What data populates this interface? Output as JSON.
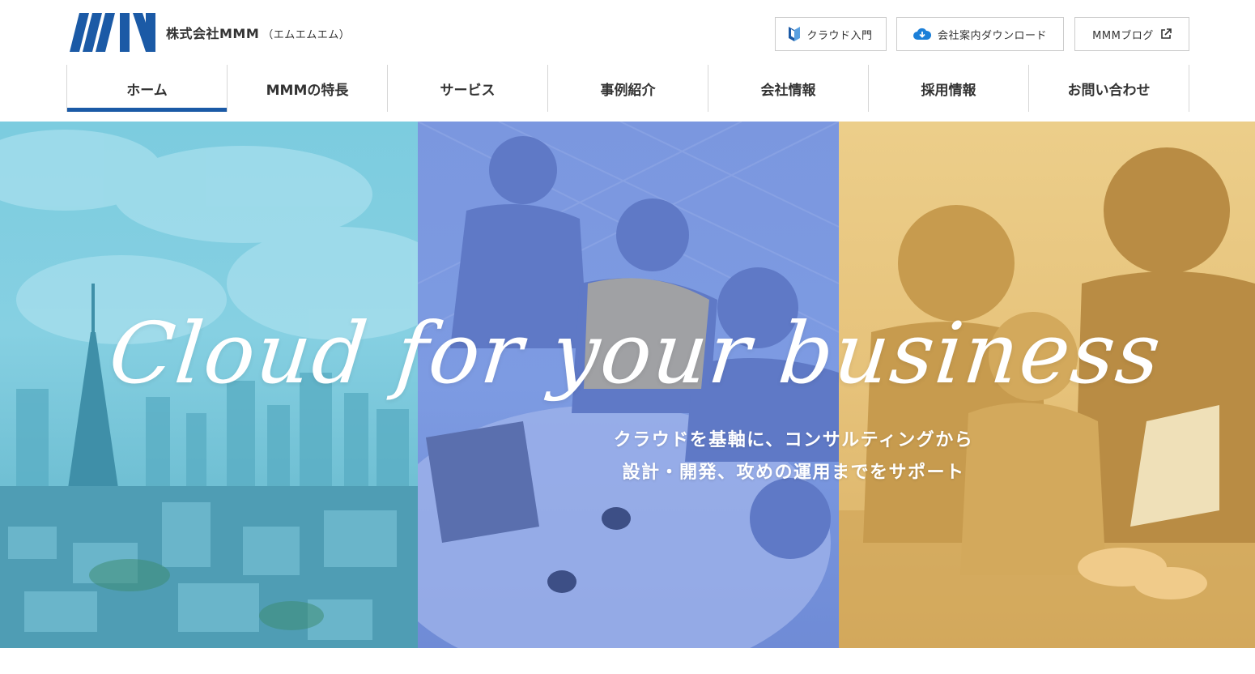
{
  "header": {
    "company_name": "株式会社MMM",
    "company_reading": "（エムエムエム）",
    "logo_alt": "MMM logo"
  },
  "utility_links": [
    {
      "label": "クラウド入門",
      "icon": "shield-beginner-icon"
    },
    {
      "label": "会社案内ダウンロード",
      "icon": "cloud-download-icon"
    },
    {
      "label": "MMMブログ",
      "icon": "external-link-icon"
    }
  ],
  "nav": {
    "items": [
      {
        "label": "ホーム",
        "active": true
      },
      {
        "label": "MMMの特長",
        "active": false
      },
      {
        "label": "サービス",
        "active": false
      },
      {
        "label": "事例紹介",
        "active": false
      },
      {
        "label": "会社情報",
        "active": false
      },
      {
        "label": "採用情報",
        "active": false
      },
      {
        "label": "お問い合わせ",
        "active": false
      }
    ]
  },
  "hero": {
    "title": "Cloud for your business",
    "subtitle_line1": "クラウドを基軸に、コンサルティングから",
    "subtitle_line2": "設計・開発、攻めの運用までをサポート"
  },
  "colors": {
    "brand_blue": "#1b5aa6",
    "city_tint": "#7cccdf",
    "office_tint": "#7b97df",
    "family_tint": "#e6c27a"
  }
}
